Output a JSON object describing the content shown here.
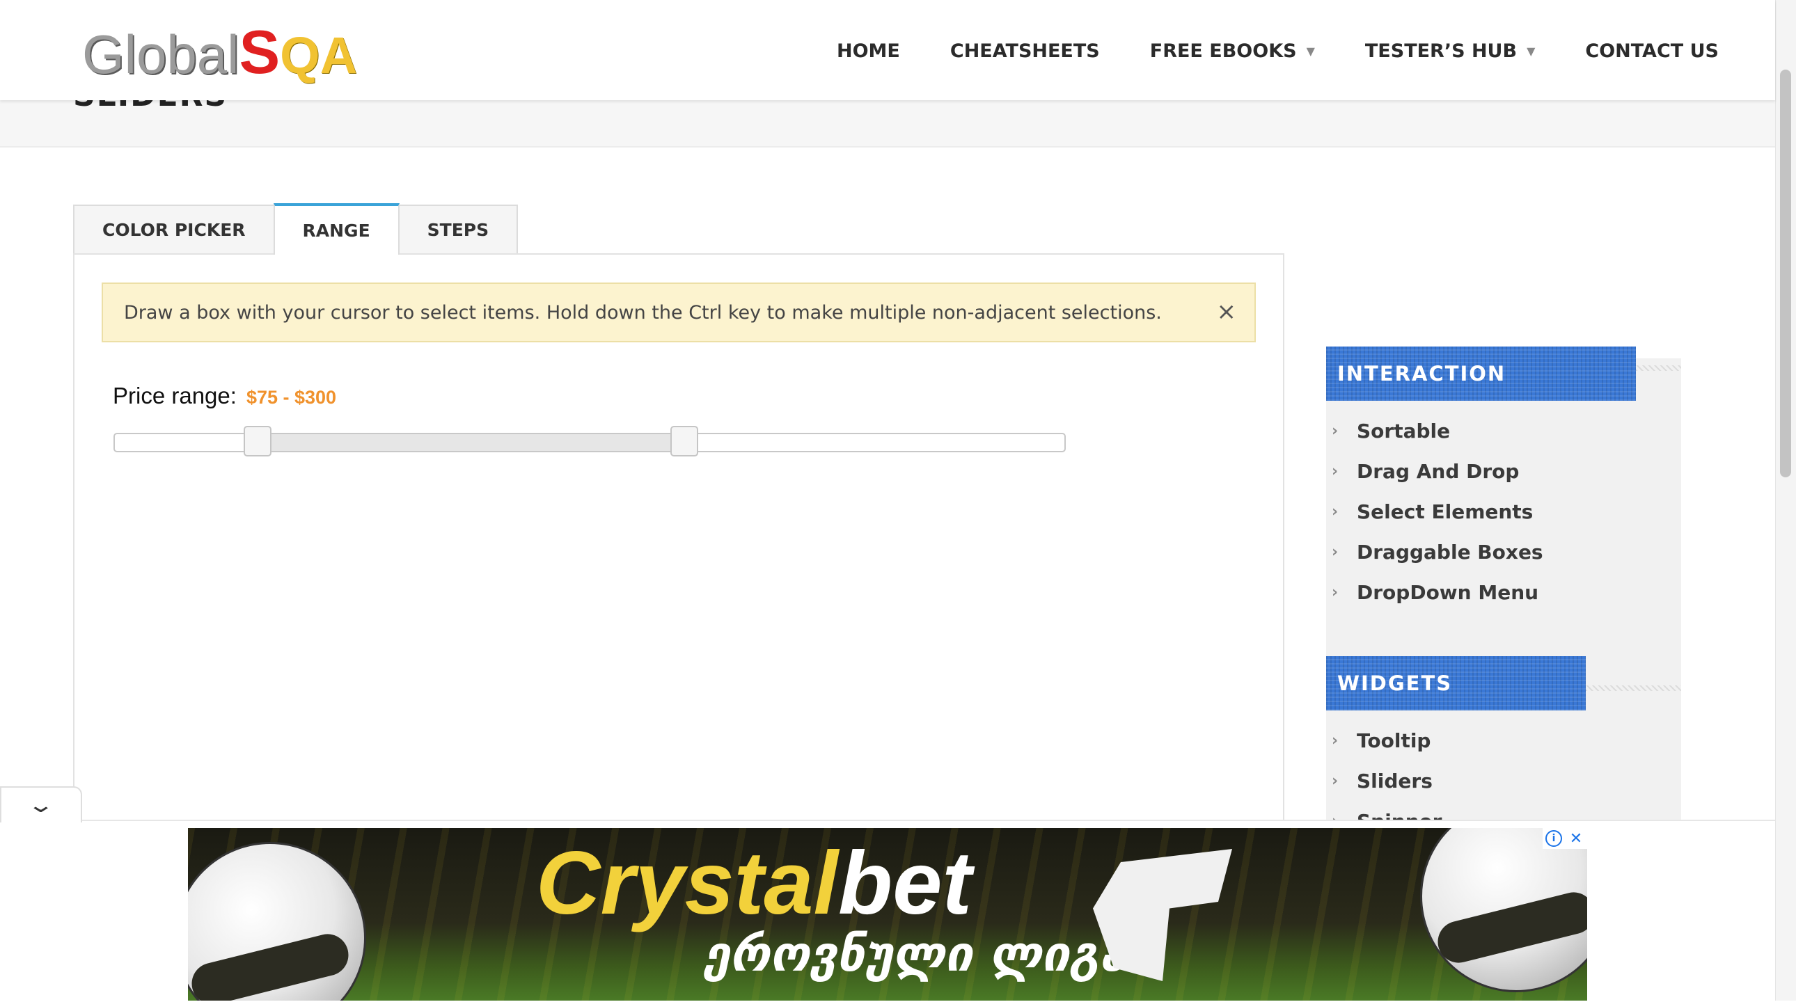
{
  "header": {
    "logo": {
      "part1": "Global",
      "part2": "S",
      "part3": "QA"
    },
    "nav": [
      {
        "label": "HOME",
        "dropdown": false
      },
      {
        "label": "CHEATSHEETS",
        "dropdown": false
      },
      {
        "label": "FREE EBOOKS",
        "dropdown": true
      },
      {
        "label": "TESTER’S HUB",
        "dropdown": true
      },
      {
        "label": "CONTACT US",
        "dropdown": false
      }
    ],
    "dropdown_icon": "chevron-down-icon"
  },
  "page": {
    "title": "SLIDERS"
  },
  "tabs": [
    {
      "label": "COLOR PICKER",
      "active": false
    },
    {
      "label": "RANGE",
      "active": true
    },
    {
      "label": "STEPS",
      "active": false
    }
  ],
  "info": {
    "text": "Draw a box with your cursor to select items. Hold down the Ctrl key to make multiple non-adjacent selections.",
    "close_symbol": "×"
  },
  "slider": {
    "label": "Price range:",
    "value_text": "$75 - $300",
    "min": 0,
    "max": 500,
    "low": 75,
    "high": 300
  },
  "sidebar": {
    "interaction": {
      "title": "INTERACTION",
      "items": [
        "Sortable",
        "Drag And Drop",
        "Select Elements",
        "Draggable Boxes",
        "DropDown Menu"
      ]
    },
    "widgets": {
      "title": "WIDGETS",
      "items": [
        "Tooltip",
        "Sliders",
        "Spinner"
      ]
    },
    "item_icon": "chevron-right-icon"
  },
  "ad": {
    "brand_part1": "Crystal",
    "brand_part2": "bet",
    "subtitle": "ეროვნული ლიგა",
    "info_symbol": "i",
    "close_symbol": "✕"
  },
  "colors": {
    "accent_tab": "#3aa3d8",
    "price_value": "#f0922d",
    "widget_title_bg": "#3a78d6",
    "info_bg": "#fcf3cf"
  }
}
